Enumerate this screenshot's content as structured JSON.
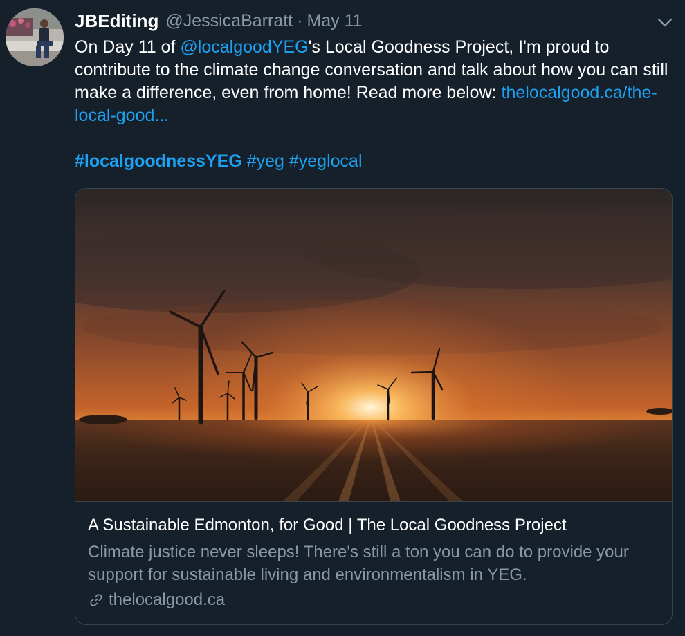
{
  "tweet": {
    "display_name": "JBEditing",
    "handle": "@JessicaBarratt",
    "separator": "·",
    "date": "May 11",
    "text_part1": "On Day 11 of ",
    "mention": "@localgoodYEG",
    "text_part2": "'s Local Goodness Project, I'm proud to contribute to the climate change conversation and talk about how you can still make a difference, even from home! Read more below: ",
    "url_text": "thelocalgood.ca/the-local-good...",
    "hashtags": [
      "#localgoodnessYEG",
      "#yeg",
      "#yeglocal"
    ]
  },
  "card": {
    "title": "A Sustainable Edmonton, for Good | The Local Goodness Project",
    "description": "Climate justice never sleeps! There's still a ton you can do to provide your support for sustainable living and environmentalism in YEG.",
    "domain": "thelocalgood.ca"
  },
  "icons": {
    "caret": "chevron-down-icon",
    "link": "link-icon"
  },
  "colors": {
    "background": "#15202b",
    "link": "#1da1f2",
    "secondary_text": "#8899a6",
    "border": "#38444d"
  }
}
